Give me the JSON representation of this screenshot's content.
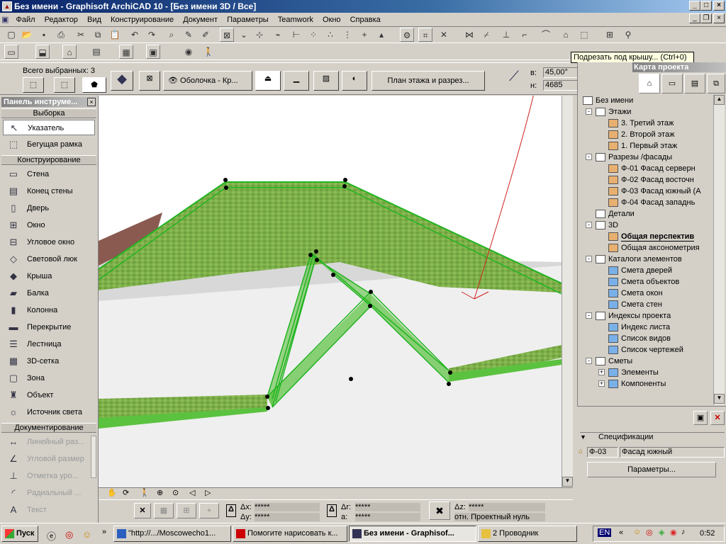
{
  "window": {
    "title": "Без имени - Graphisoft ArchiCAD 10 - [Без имени 3D / Все]",
    "minimize": "_",
    "maximize": "□",
    "close": "×"
  },
  "menu": [
    "Файл",
    "Редактор",
    "Вид",
    "Конструирование",
    "Документ",
    "Параметры",
    "Teamwork",
    "Окно",
    "Справка"
  ],
  "tooltip": "Подрезать под крышу... (Ctrl+0)",
  "infobox": {
    "selected": "Всего выбранных: 3",
    "shell_dropdown": "Оболочка - Кр...",
    "plan_button": "План этажа и разрез...",
    "angle_label": "в:",
    "angle_value": "45,00°",
    "height_label": "н:",
    "height_value": "4685"
  },
  "toolbox": {
    "title": "Панель инструме...",
    "sections": {
      "select": "Выборка",
      "construct": "Конструирование",
      "document": "Документирование"
    },
    "select_items": [
      {
        "label": "Указатель",
        "icon": "pointer-icon"
      },
      {
        "label": "Бегущая рамка",
        "icon": "marquee-icon"
      }
    ],
    "construct_items": [
      {
        "label": "Стена",
        "icon": "wall-icon"
      },
      {
        "label": "Конец стены",
        "icon": "wall-end-icon"
      },
      {
        "label": "Дверь",
        "icon": "door-icon"
      },
      {
        "label": "Окно",
        "icon": "window-icon"
      },
      {
        "label": "Угловое окно",
        "icon": "corner-window-icon"
      },
      {
        "label": "Световой люк",
        "icon": "skylight-icon"
      },
      {
        "label": "Крыша",
        "icon": "roof-icon"
      },
      {
        "label": "Балка",
        "icon": "beam-icon"
      },
      {
        "label": "Колонна",
        "icon": "column-icon"
      },
      {
        "label": "Перекрытие",
        "icon": "slab-icon"
      },
      {
        "label": "Лестница",
        "icon": "stair-icon"
      },
      {
        "label": "3D-сетка",
        "icon": "mesh-icon"
      },
      {
        "label": "Зона",
        "icon": "zone-icon"
      },
      {
        "label": "Объект",
        "icon": "object-icon"
      },
      {
        "label": "Источник света",
        "icon": "light-icon"
      }
    ],
    "document_items": [
      {
        "label": "Линейный раз...",
        "icon": "linear-dimension-icon"
      },
      {
        "label": "Угловой размер",
        "icon": "angle-dimension-icon"
      },
      {
        "label": "Отметка уро...",
        "icon": "level-dimension-icon"
      },
      {
        "label": "Радиальный ...",
        "icon": "radial-dimension-icon"
      },
      {
        "label": "Текст",
        "icon": "text-icon"
      }
    ]
  },
  "navigator": {
    "title": "Карта проекта",
    "tree": [
      {
        "label": "Без имени",
        "depth": 0,
        "expander": "-"
      },
      {
        "label": "Этажи",
        "depth": 1,
        "expander": "-"
      },
      {
        "label": "3. Третий этаж",
        "depth": 2
      },
      {
        "label": "2. Второй этаж",
        "depth": 2
      },
      {
        "label": "1. Первый этаж",
        "depth": 2
      },
      {
        "label": "Разрезы /фасады",
        "depth": 1,
        "expander": "-"
      },
      {
        "label": "Ф-01 Фасад серверн",
        "depth": 2
      },
      {
        "label": "Ф-02 Фасад восточн",
        "depth": 2
      },
      {
        "label": "Ф-03 Фасад южный (А",
        "depth": 2
      },
      {
        "label": "Ф-04 Фасад западнь",
        "depth": 2
      },
      {
        "label": "Детали",
        "depth": 1
      },
      {
        "label": "3D",
        "depth": 1,
        "expander": "-"
      },
      {
        "label": "Общая перспектив",
        "depth": 2,
        "selected": true
      },
      {
        "label": "Общая аксонометрия",
        "depth": 2
      },
      {
        "label": "Каталоги элементов",
        "depth": 1,
        "expander": "-"
      },
      {
        "label": "Смета дверей",
        "depth": 2
      },
      {
        "label": "Смета объектов",
        "depth": 2
      },
      {
        "label": "Смета окон",
        "depth": 2
      },
      {
        "label": "Смета стен",
        "depth": 2
      },
      {
        "label": "Индексы проекта",
        "depth": 1,
        "expander": "-"
      },
      {
        "label": "Индекс листа",
        "depth": 2
      },
      {
        "label": "Список видов",
        "depth": 2
      },
      {
        "label": "Список чертежей",
        "depth": 2
      },
      {
        "label": "Сметы",
        "depth": 1,
        "expander": "-"
      },
      {
        "label": "Элементы",
        "depth": 2,
        "expander": "+"
      },
      {
        "label": "Компоненты",
        "depth": 2,
        "expander": "+"
      }
    ],
    "specs_label": "Спецификации",
    "spec_code": "Ф-03",
    "spec_name": "Фасад южный",
    "params_button": "Параметры..."
  },
  "status": {
    "dx_label": "Δx:",
    "dx_value": "*****",
    "dy_label": "Δy:",
    "dy_value": "*****",
    "dr_label": "Δr:",
    "dr_value": "*****",
    "a_label": "a:",
    "a_value": "*****",
    "dz_label": "Δz:",
    "dz_value": "*****",
    "ref_label": "отн. Проектный нуль"
  },
  "taskbar": {
    "start": "Пуск",
    "tasks": [
      {
        "label": "\"http://.../Moscowecho1...",
        "active": false
      },
      {
        "label": "Помогите нарисовать к...",
        "active": false
      },
      {
        "label": "Без имени - Graphisof...",
        "active": true
      },
      {
        "label": "2 Проводник",
        "active": false
      }
    ],
    "lang": "EN",
    "clock": "0:52"
  },
  "colors": {
    "titlebar_start": "#0a246a",
    "selection_green": "#22b422",
    "roof_green": "#7db04a",
    "wall_brown": "#8a5a50",
    "annotation_red": "#d02020"
  }
}
